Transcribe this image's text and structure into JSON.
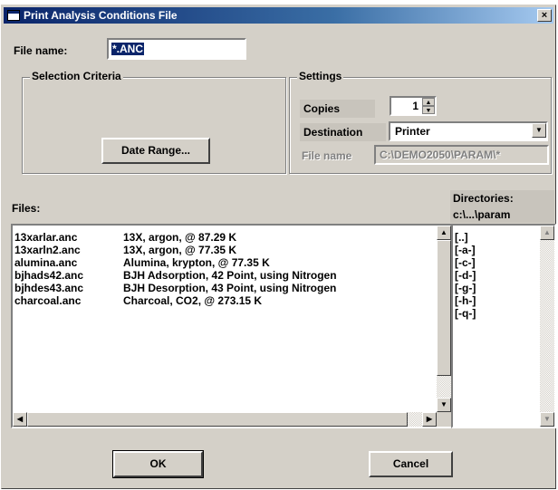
{
  "window": {
    "title": "Print Analysis Conditions File",
    "close_glyph": "×"
  },
  "file_name": {
    "label": "File name:",
    "value": "*.ANC"
  },
  "selection_criteria": {
    "title": "Selection Criteria",
    "date_range_button": "Date Range..."
  },
  "settings": {
    "title": "Settings",
    "copies_label": "Copies",
    "copies_value": "1",
    "destination_label": "Destination",
    "destination_value": "Printer",
    "file_name_label": "File name",
    "file_name_value": "C:\\DEMO2050\\PARAM\\*"
  },
  "files": {
    "label": "Files:",
    "rows": [
      {
        "name": "13xarlar.anc",
        "desc": "13X, argon, @ 87.29 K"
      },
      {
        "name": "13xarln2.anc",
        "desc": "13X, argon, @ 77.35 K"
      },
      {
        "name": "alumina.anc",
        "desc": "Alumina, krypton, @ 77.35 K"
      },
      {
        "name": "bjhads42.anc",
        "desc": "BJH Adsorption, 42 Point, using Nitrogen"
      },
      {
        "name": "bjhdes43.anc",
        "desc": "BJH Desorption, 43 Point, using Nitrogen"
      },
      {
        "name": "charcoal.anc",
        "desc": "Charcoal, CO2, @ 273.15 K"
      }
    ]
  },
  "directories": {
    "label": "Directories:",
    "path": "c:\\...\\param",
    "items": [
      "[..]",
      "[-a-]",
      "[-c-]",
      "[-d-]",
      "[-g-]",
      "[-h-]",
      "[-q-]"
    ]
  },
  "buttons": {
    "ok": "OK",
    "cancel": "Cancel"
  }
}
